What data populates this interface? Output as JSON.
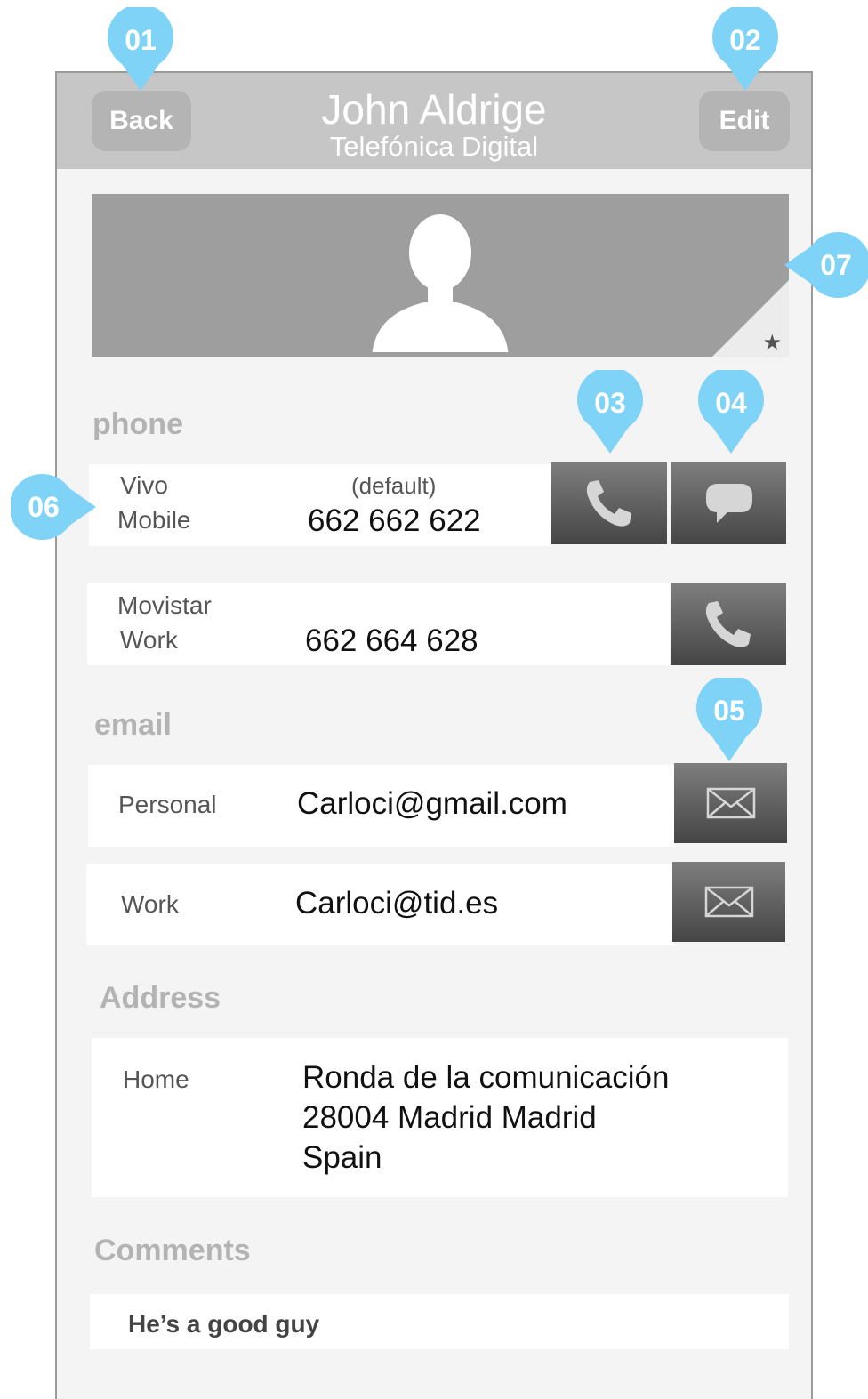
{
  "header": {
    "back_label": "Back",
    "edit_label": "Edit",
    "name": "John Aldrige",
    "company": "Telefónica Digital"
  },
  "photo": {
    "favorite_icon": "star-icon",
    "avatar_icon": "person-silhouette-icon"
  },
  "phone": {
    "section_title": "phone",
    "entries": [
      {
        "carrier": "Vivo",
        "type": "Mobile",
        "note": "(default)",
        "number": "662 662 622",
        "actions": [
          "phone-icon",
          "chat-bubble-icon"
        ]
      },
      {
        "carrier": "Movistar",
        "type": "Work",
        "number": "662 664 628",
        "actions": [
          "phone-icon"
        ]
      }
    ]
  },
  "email": {
    "section_title": "email",
    "entries": [
      {
        "type": "Personal",
        "address": "Carloci@gmail.com",
        "action": "envelope-icon"
      },
      {
        "type": "Work",
        "address": "Carloci@tid.es",
        "action": "envelope-icon"
      }
    ]
  },
  "address": {
    "section_title": "Address",
    "entries": [
      {
        "type": "Home",
        "line1": "Ronda de la comunicación",
        "line2": "28004 Madrid Madrid",
        "line3": "Spain"
      }
    ]
  },
  "comments": {
    "section_title": "Comments",
    "text": "He’s a good guy"
  },
  "annotations": [
    "01",
    "02",
    "03",
    "04",
    "05",
    "06",
    "07"
  ],
  "colors": {
    "marker": "#7fd3f7",
    "header": "#c6c6c6",
    "header_button": "#b4b4b4",
    "section_title": "#b3b3b3",
    "action_button_top": "#7e7e7e",
    "action_button_bottom": "#454545"
  }
}
